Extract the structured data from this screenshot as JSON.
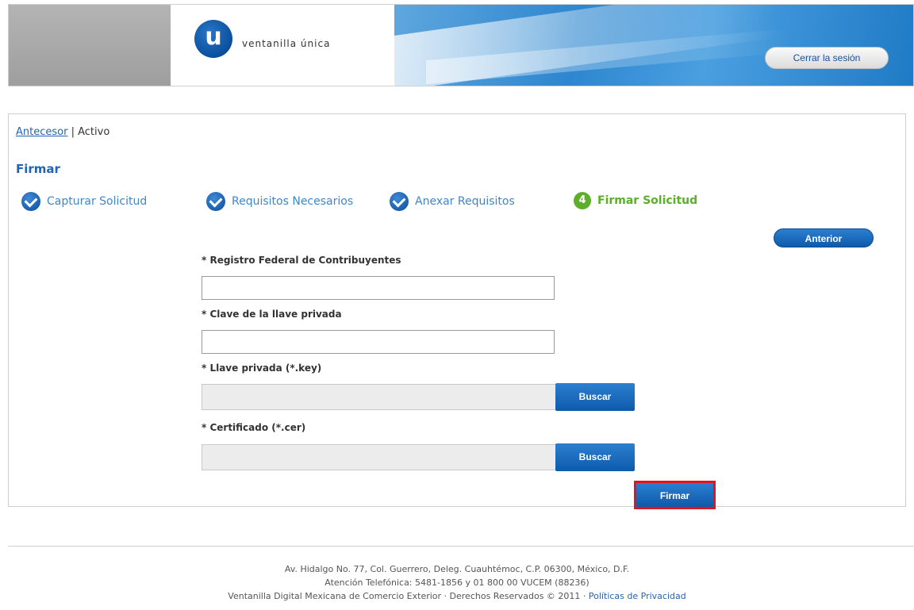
{
  "header": {
    "logo_letter": "u",
    "logo_text": "ventanilla única",
    "logout_label": "Cerrar la sesión"
  },
  "breadcrumb": {
    "parent_link": "Antecesor",
    "separator": " | ",
    "current": "Activo"
  },
  "page_title": "Firmar",
  "steps": [
    {
      "label": "Capturar Solicitud",
      "status": "done",
      "icon": "check-circle-icon"
    },
    {
      "label": "Requisitos Necesarios",
      "status": "done",
      "icon": "check-circle-icon"
    },
    {
      "label": "Anexar Requisitos",
      "status": "done",
      "icon": "check-circle-icon"
    },
    {
      "number": "4",
      "label": "Firmar Solicitud",
      "status": "active"
    }
  ],
  "buttons": {
    "previous": "Anterior",
    "browse_key": "Buscar",
    "browse_cert": "Buscar",
    "sign": "Firmar"
  },
  "form": {
    "rfc": {
      "label": "* Registro Federal de Contribuyentes",
      "value": ""
    },
    "private_key_password": {
      "label": "* Clave de la llave privada",
      "value": ""
    },
    "private_key_file": {
      "label": "* Llave privada (*.key)",
      "value": ""
    },
    "certificate_file": {
      "label": "* Certificado (*.cer)",
      "value": ""
    }
  },
  "footer": {
    "address": "Av. Hidalgo No. 77, Col. Guerrero, Deleg. Cuauhtémoc, C.P. 06300, México, D.F.",
    "phone": "Atención Telefónica: 5481-1856 y 01 800 00 VUCEM (88236)",
    "rights": "Ventanilla Digital Mexicana de Comercio Exterior · Derechos Reservados © 2011 · ",
    "privacy_link": "Políticas de Privacidad"
  },
  "colors": {
    "brand_blue": "#1f64b5",
    "active_green": "#5cae2b",
    "highlight_red": "#e4141c"
  }
}
